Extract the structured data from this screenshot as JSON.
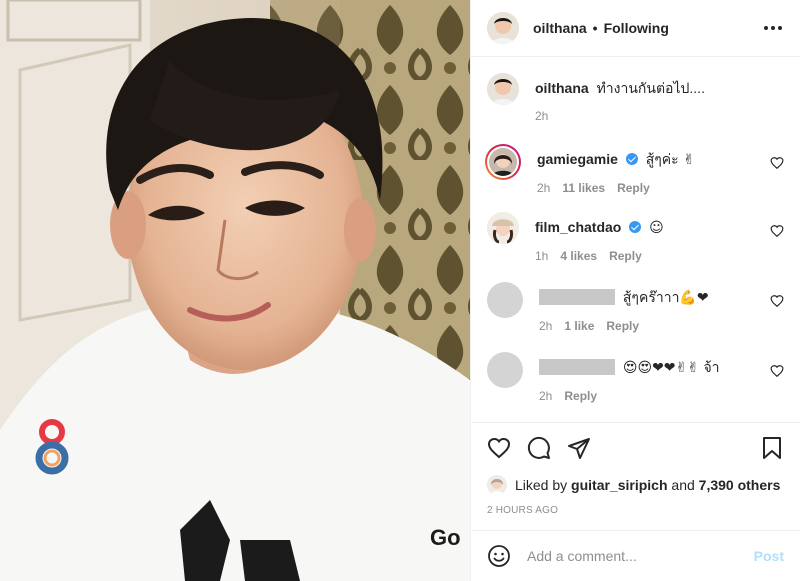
{
  "header": {
    "username": "oilthana",
    "separator": "•",
    "follow_state": "Following",
    "more_icon": "more-horizontal-icon"
  },
  "caption": {
    "username": "oilthana",
    "text": "ทำงานกันต่อไป....",
    "time": "2h"
  },
  "comments": [
    {
      "username": "gamiegamie",
      "verified": true,
      "text": "สู้ๆค่ะ ✌",
      "time": "2h",
      "likes": "11 likes",
      "reply": "Reply",
      "has_story_ring": true
    },
    {
      "username": "film_chatdao",
      "verified": true,
      "text": "☺",
      "time": "1h",
      "likes": "4 likes",
      "reply": "Reply"
    },
    {
      "username": "",
      "redacted": true,
      "text": "สู้ๆคร๊าาา💪❤",
      "time": "2h",
      "likes": "1 like",
      "reply": "Reply"
    },
    {
      "username": "",
      "redacted": true,
      "text": "😍😍❤❤✌✌ จ้า",
      "time": "2h",
      "reply": "Reply"
    }
  ],
  "actions": {
    "like_icon": "heart-icon",
    "comment_icon": "comment-icon",
    "share_icon": "share-icon",
    "save_icon": "bookmark-icon"
  },
  "likes_summary": {
    "prefix": "Liked by",
    "user": "guitar_siripich",
    "connector": "and",
    "others": "7,390 others"
  },
  "timestamp": "2 HOURS AGO",
  "add_comment": {
    "placeholder": "Add a comment...",
    "post_label": "Post"
  },
  "colors": {
    "accent_blue": "#3897f0",
    "post_disabled": "#b2dffc",
    "heart_red": "#ed4956",
    "meta_gray": "#8e8e8e"
  }
}
